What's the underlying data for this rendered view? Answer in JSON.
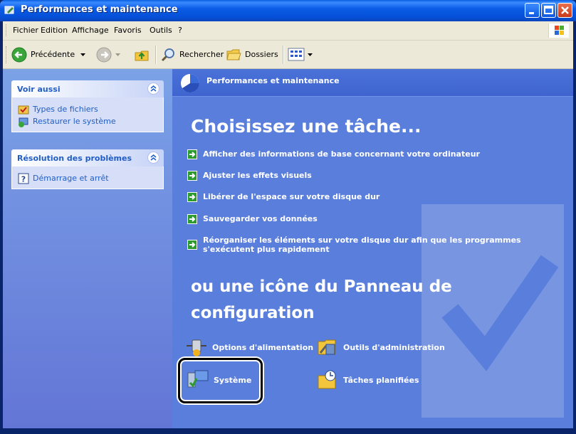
{
  "window": {
    "title": "Performances et maintenance",
    "controls": [
      "minimize",
      "maximize",
      "close"
    ]
  },
  "menubar": {
    "items": [
      "Fichier",
      "Edition",
      "Affichage",
      "Favoris",
      "Outils",
      "?"
    ]
  },
  "toolbar": {
    "back_label": "Précédente",
    "search_label": "Rechercher",
    "folders_label": "Dossiers"
  },
  "sidebar": {
    "see_also": {
      "title": "Voir aussi",
      "items": [
        "Types de fichiers",
        "Restaurer le système"
      ]
    },
    "troubleshoot": {
      "title": "Résolution des problèmes",
      "items": [
        "Démarrage et arrêt"
      ]
    }
  },
  "main": {
    "category_title": "Performances et maintenance",
    "pick_task_heading": "Choisissez une tâche...",
    "tasks": [
      "Afficher des informations de base concernant votre ordinateur",
      "Ajuster les effets visuels",
      "Libérer de l'espace sur votre disque dur",
      "Sauvegarder vos données",
      "Réorganiser les éléments sur votre disque dur afin que les programmes s'exécutent plus rapidement"
    ],
    "pick_icon_heading_line1": "ou une icône du Panneau de",
    "pick_icon_heading_line2": "configuration",
    "icons": [
      "Options d'alimentation",
      "Outils d'administration",
      "Système",
      "Tâches planifiées"
    ]
  },
  "colors": {
    "title_bar": "#0b5ce6",
    "main_pane": "#5a7edc",
    "left_pane": "#7ba2e7",
    "link_blue": "#215dc6"
  }
}
